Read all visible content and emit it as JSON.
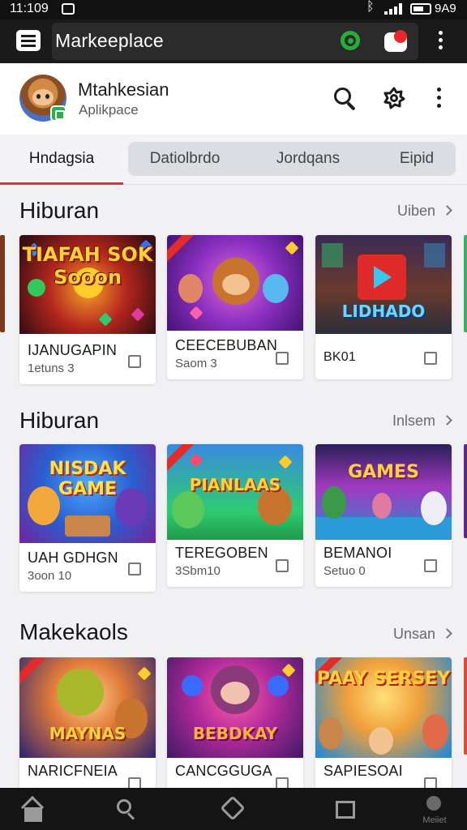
{
  "status_bar": {
    "time": "11:109",
    "battery": "9A9"
  },
  "toolbar": {
    "title": "Markeeplace"
  },
  "app_header": {
    "name": "Mtahkesian",
    "subtitle": "Aplikpace"
  },
  "tabs": [
    {
      "label": "Hndagsia",
      "active": true
    },
    {
      "label": "Datiolbrdo",
      "active": false
    },
    {
      "label": "Jordqans",
      "active": false
    },
    {
      "label": "Eipid",
      "active": false
    }
  ],
  "sections": [
    {
      "title": "Hiburan",
      "see_all": "Uiben",
      "cards": [
        {
          "image_text": "TIAFAH SOK Sooon",
          "name": "IJANUGAPIN",
          "sub": "1etuns 3"
        },
        {
          "image_text": "",
          "name": "CEECEBUBAN",
          "sub": "Saom 3"
        },
        {
          "image_text": "LIDHADO",
          "name": "BK01",
          "sub": ""
        }
      ]
    },
    {
      "title": "Hiburan",
      "see_all": "Inlsem",
      "cards": [
        {
          "image_text": "NISDAK GAME",
          "name": "UAH GDHGN",
          "sub": "3oon 10"
        },
        {
          "image_text": "PIANLAAS",
          "name": "TEREGOBEN",
          "sub": "3Sbm10"
        },
        {
          "image_text": "GAMES",
          "name": "BEMANOI",
          "sub": "Setuo 0"
        }
      ]
    },
    {
      "title": "Makekaols",
      "see_all": "Unsan",
      "cards": [
        {
          "image_text": "MAYNAS",
          "name": "NARICFNEIA",
          "sub": ""
        },
        {
          "image_text": "BEBDKAY",
          "name": "CANCGGUGA",
          "sub": ""
        },
        {
          "image_text": "PAAY SERSEY",
          "name": "SAPIESOAI",
          "sub": ""
        }
      ]
    }
  ],
  "bottom_nav": {
    "profile_label": "Meiiet"
  },
  "colors": {
    "accent": "#e0322f",
    "toolbar": "#1a1a1a",
    "green": "#27ae3a"
  }
}
